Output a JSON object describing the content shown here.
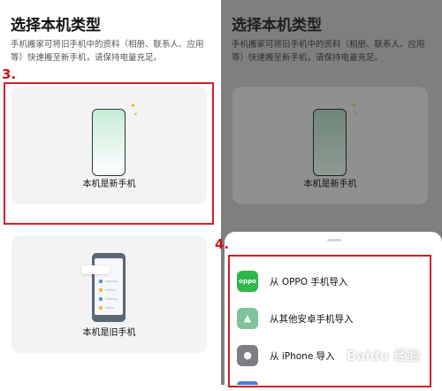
{
  "left_screen": {
    "title": "选择本机类型",
    "description": "手机搬家可将旧手机中的资料（相册、联系人、应用等）快速搬至新手机，请保持电量充足。",
    "new_phone_label": "本机是新手机",
    "old_phone_label": "本机是旧手机"
  },
  "right_screen": {
    "title": "选择本机类型",
    "description": "手机搬家可将旧手机中的资料（相册、联系人、应用等）快速搬至新手机，请保持电量充足。",
    "new_phone_label": "本机是新手机"
  },
  "step_labels": [
    "3.",
    "4."
  ],
  "import_sheet": {
    "options": [
      {
        "label": "从 OPPO 手机导入",
        "icon": "oppo-logo-icon",
        "icon_text": "oppo",
        "color": "#2db84b"
      },
      {
        "label": "从其他安卓手机导入",
        "icon": "android-icon",
        "icon_text": "▲",
        "color": "#7ec39a"
      },
      {
        "label": "从 iPhone 导入",
        "icon": "apple-icon",
        "icon_text": "●",
        "color": "#7d7d86"
      }
    ]
  },
  "watermark": "Baidu 经验",
  "colors": {
    "highlight": "#d11f24",
    "oppo_green": "#2db84b"
  }
}
